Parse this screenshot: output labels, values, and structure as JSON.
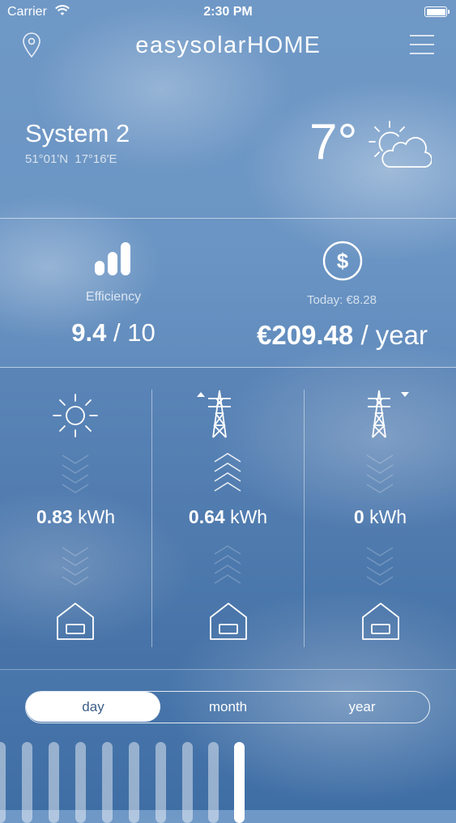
{
  "status_bar": {
    "carrier": "Carrier",
    "time": "2:30 PM"
  },
  "header": {
    "logo_main": "easysolar",
    "logo_sub": "HOME",
    "left_icon": "location-pin-icon",
    "right_icon": "hamburger-menu-icon"
  },
  "system": {
    "name": "System 2",
    "lat": "51°01'N",
    "lon": "17°16'E"
  },
  "weather": {
    "temperature": "7°",
    "icon": "partly-cloudy-icon"
  },
  "efficiency": {
    "label": "Efficiency",
    "value": "9.4",
    "max": "/ 10"
  },
  "earnings": {
    "today": "Today: €8.28",
    "value": "€209.48",
    "period": "/ year"
  },
  "flows": [
    {
      "value": "0.83",
      "unit": "kWh",
      "source_icon": "sun-icon",
      "arrow_direction": "down"
    },
    {
      "value": "0.64",
      "unit": "kWh",
      "source_icon": "power-pylon-export-icon",
      "arrow_direction": "up"
    },
    {
      "value": "0",
      "unit": "kWh",
      "source_icon": "power-pylon-import-icon",
      "arrow_direction": "down"
    }
  ],
  "period_tabs": {
    "selected": "day",
    "items": [
      "day",
      "month",
      "year"
    ]
  },
  "bars": {
    "count": 10,
    "active_index": 9
  }
}
